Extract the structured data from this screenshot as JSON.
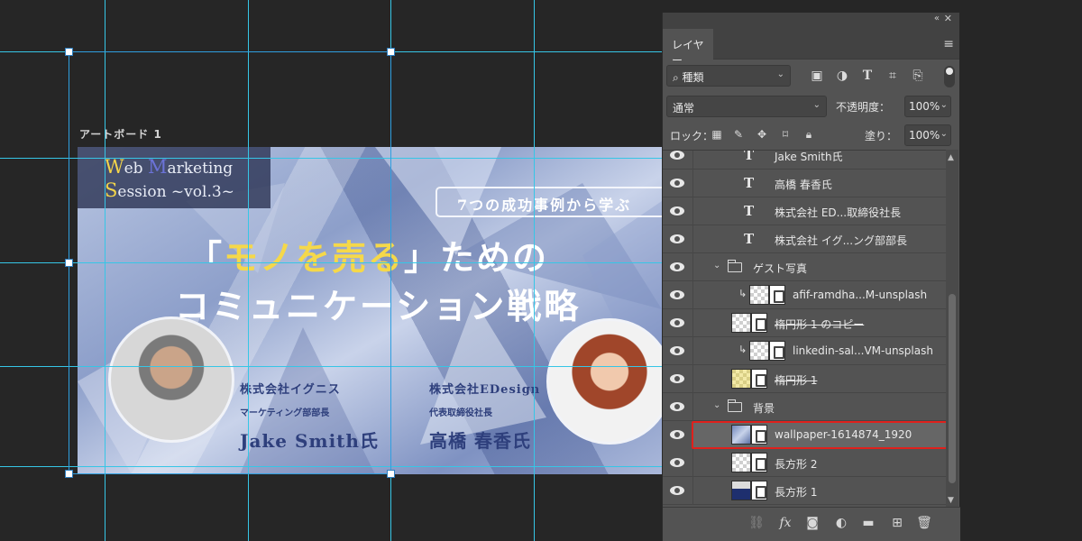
{
  "canvas": {
    "artboard_label": "アートボード 1",
    "banner": {
      "title_line1": "eb ",
      "title_line1_initial": "W",
      "title_line1_m": "M",
      "title_line1_rest": "arketing",
      "title_line2_initial": "S",
      "title_line2_rest": "ession ~vol.3~",
      "badge": "7つの成功事例から学ぶ",
      "headline_bracket_open": "「",
      "headline_highlight": "モノを売る",
      "headline_rest": "」ためのコ",
      "headline_line1_tail": "ための",
      "headline_line2": "コミュニケーション戦略",
      "guest_left": {
        "company": "株式会社イグニス",
        "role": "マーケティング部部長",
        "name": "Jake Smith氏"
      },
      "guest_right": {
        "company": "株式会社EDesign",
        "role": "代表取締役社長",
        "name": "高橋 春香氏"
      }
    }
  },
  "panel": {
    "tab": "レイヤー",
    "filter_kind": "種類",
    "blend_mode": "通常",
    "opacity_label": "不透明度：",
    "opacity_value": "100%",
    "lock_label": "ロック：",
    "fill_label": "塗り：",
    "fill_value": "100%",
    "layers": [
      {
        "name": "Jake Smith氏",
        "kind": "text"
      },
      {
        "name": "高橋 春香氏",
        "kind": "text"
      },
      {
        "name": "株式会社 ED...取締役社長",
        "kind": "text"
      },
      {
        "name": "株式会社 イグ...ング部部長",
        "kind": "text"
      },
      {
        "name": "ゲスト写真",
        "kind": "group"
      },
      {
        "name": "afif-ramdha...M-unsplash",
        "kind": "smart-clipped"
      },
      {
        "name": "楕円形 1 のコピー",
        "kind": "shape"
      },
      {
        "name": "linkedin-sal...VM-unsplash",
        "kind": "smart-clipped"
      },
      {
        "name": "楕円形 1",
        "kind": "shape"
      },
      {
        "name": "背景",
        "kind": "group"
      },
      {
        "name": "wallpaper-1614874_1920",
        "kind": "smart-selected"
      },
      {
        "name": "長方形 2",
        "kind": "shape"
      },
      {
        "name": "長方形 1",
        "kind": "shape-blue"
      }
    ]
  },
  "colors": {
    "guide": "#36c6e6",
    "selection_outline": "#e0201c",
    "headline_highlight": "#f5d84a",
    "panel_bg": "#535353"
  }
}
